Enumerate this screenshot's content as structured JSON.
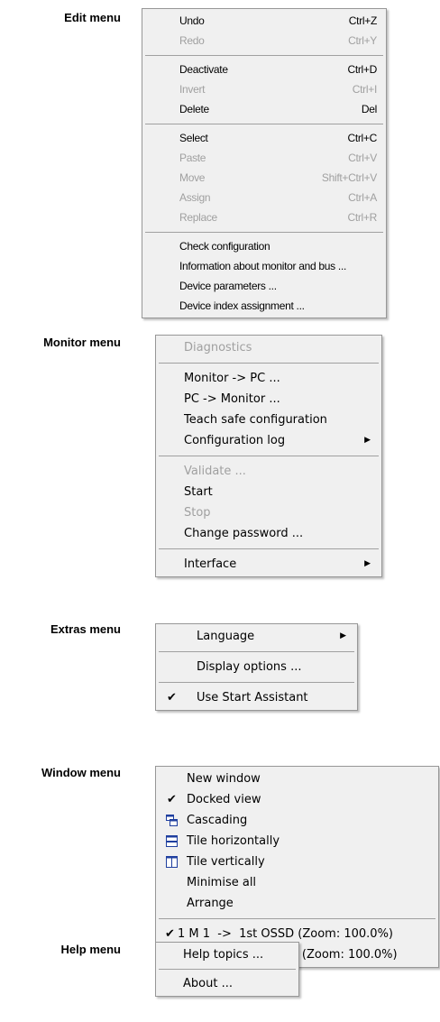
{
  "labels": {
    "edit": "Edit menu",
    "monitor": "Monitor menu",
    "extras": "Extras menu",
    "window": "Window menu",
    "help": "Help menu"
  },
  "edit_menu": {
    "undo": {
      "label": "Undo",
      "shortcut": "Ctrl+Z"
    },
    "redo": {
      "label": "Redo",
      "shortcut": "Ctrl+Y"
    },
    "deactivate": {
      "label": "Deactivate",
      "shortcut": "Ctrl+D"
    },
    "invert": {
      "label": "Invert",
      "shortcut": "Ctrl+I"
    },
    "delete": {
      "label": "Delete",
      "shortcut": "Del"
    },
    "select": {
      "label": "Select",
      "shortcut": "Ctrl+C"
    },
    "paste": {
      "label": "Paste",
      "shortcut": "Ctrl+V"
    },
    "move": {
      "label": "Move",
      "shortcut": "Shift+Ctrl+V"
    },
    "assign": {
      "label": "Assign",
      "shortcut": "Ctrl+A"
    },
    "replace": {
      "label": "Replace",
      "shortcut": "Ctrl+R"
    },
    "check_configuration": {
      "label": "Check configuration"
    },
    "info_monitor_bus": {
      "label": "Information about monitor and bus ..."
    },
    "device_parameters": {
      "label": "Device parameters ..."
    },
    "device_index_assignment": {
      "label": "Device index assignment ..."
    }
  },
  "monitor_menu": {
    "diagnostics": {
      "label": "Diagnostics"
    },
    "monitor_to_pc": {
      "label": "Monitor -> PC ..."
    },
    "pc_to_monitor": {
      "label": "PC -> Monitor ..."
    },
    "teach_safe_config": {
      "label": "Teach safe configuration"
    },
    "configuration_log": {
      "label": "Configuration log"
    },
    "validate": {
      "label": "Validate ..."
    },
    "start": {
      "label": "Start"
    },
    "stop": {
      "label": "Stop"
    },
    "change_password": {
      "label": "Change password ..."
    },
    "interface": {
      "label": "Interface"
    }
  },
  "extras_menu": {
    "language": {
      "label": "Language"
    },
    "display_options": {
      "label": "Display options ..."
    },
    "use_start_assistant": {
      "label": "Use Start Assistant",
      "checked": true
    }
  },
  "window_menu": {
    "new_window": {
      "label": "New window"
    },
    "docked_view": {
      "label": "Docked view",
      "checked": true
    },
    "cascading": {
      "label": "Cascading",
      "icon": "cascade-icon"
    },
    "tile_horizontally": {
      "label": "Tile horizontally",
      "icon": "tile-horizontal-icon"
    },
    "tile_vertically": {
      "label": "Tile vertically",
      "icon": "tile-vertical-icon"
    },
    "minimise_all": {
      "label": "Minimise all"
    },
    "arrange": {
      "label": "Arrange"
    },
    "window1": {
      "label": "1 M 1  ->  1st OSSD (Zoom: 100.0%)",
      "checked": true
    },
    "window2": {
      "label": "2 M 2  ->  2nd OSSD (Zoom: 100.0%)"
    }
  },
  "help_menu": {
    "help_topics": {
      "label": "Help topics ..."
    },
    "about": {
      "label": "About ..."
    }
  },
  "colors": {
    "menu_bg": "#f0f0f0",
    "disabled_text": "#a0a0a0",
    "icon_blue": "#1f3f9f"
  }
}
